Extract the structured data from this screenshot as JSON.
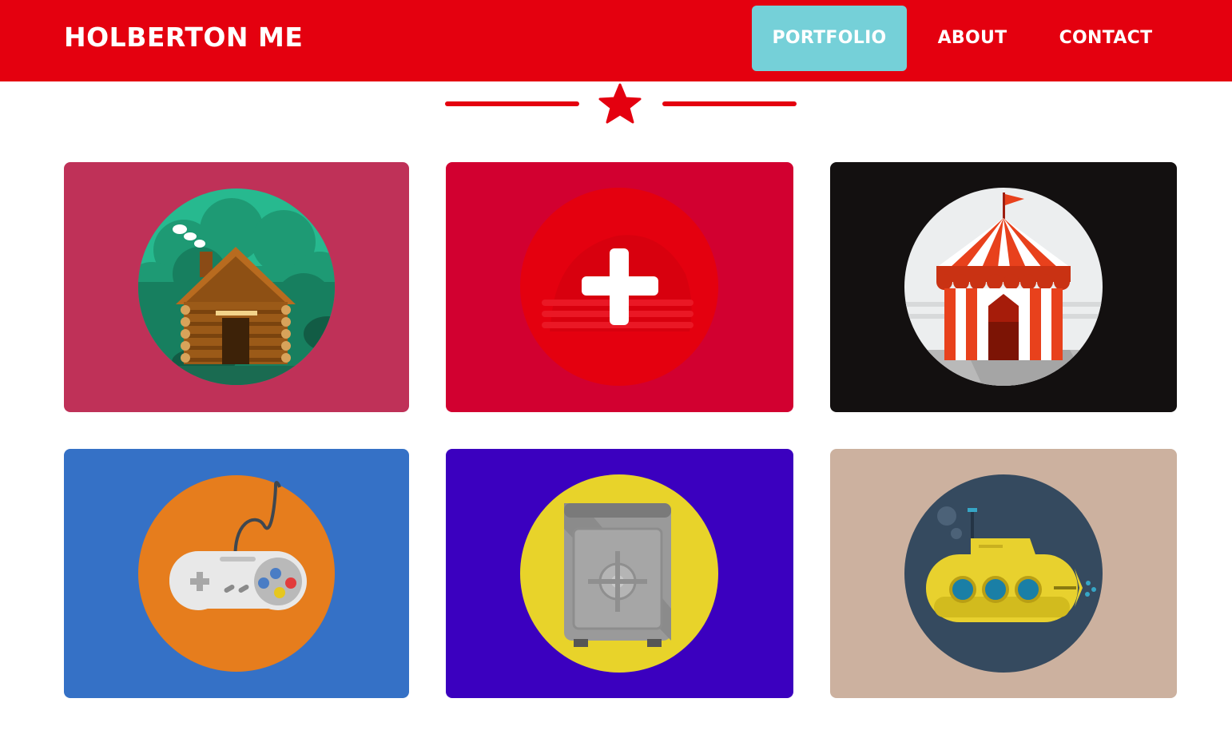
{
  "navbar": {
    "brand": "HOLBERTON ME",
    "background": "#e4000f",
    "links": [
      {
        "label": "PORTFOLIO",
        "active": true
      },
      {
        "label": "ABOUT",
        "active": false
      },
      {
        "label": "CONTACT",
        "active": false
      }
    ],
    "active_background": "#75d0d8"
  },
  "divider": {
    "icon": "star-icon",
    "color": "#e4000f"
  },
  "portfolio": {
    "items": [
      {
        "icon": "log-cabin-icon",
        "background": "#bf3158"
      },
      {
        "icon": "swiss-flag-icon",
        "background": "#d20030"
      },
      {
        "icon": "circus-tent-icon",
        "background": "#131010"
      },
      {
        "icon": "game-controller-icon",
        "background": "#3571c6"
      },
      {
        "icon": "safe-icon",
        "background": "#3b00bf"
      },
      {
        "icon": "submarine-icon",
        "background": "#ccb19f"
      }
    ]
  }
}
